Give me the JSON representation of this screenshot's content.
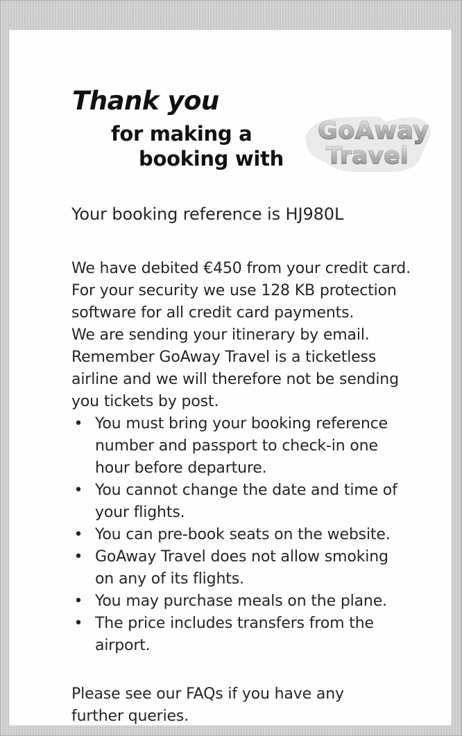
{
  "header": {
    "thank_you": "Thank you",
    "line_1": "for making a",
    "line_2": "booking with"
  },
  "logo": {
    "word_1": "GoAway",
    "word_2": "Travel"
  },
  "booking": {
    "reference_text": "Your booking reference is HJ980L"
  },
  "message": {
    "lines": [
      "We have debited €450 from your credit card.",
      "For your security we use 128 KB protection",
      "software for all credit card payments.",
      "We are sending your itinerary by email.",
      "Remember GoAway Travel is a ticketless",
      "airline and we will therefore not be sending",
      "you tickets by post."
    ]
  },
  "bullets": {
    "dot": "•",
    "items": [
      "You must bring your booking reference\nnumber and passport to check-in one\nhour before departure.",
      "You cannot change the date and time of\nyour flights.",
      "You can pre-book seats on the website.",
      "GoAway Travel does not allow smoking\non any of its flights.",
      "You may purchase meals on the plane.",
      "The price includes transfers from the\nairport."
    ]
  },
  "footer": {
    "text": "Please see our FAQs if you have any\nfurther queries."
  }
}
